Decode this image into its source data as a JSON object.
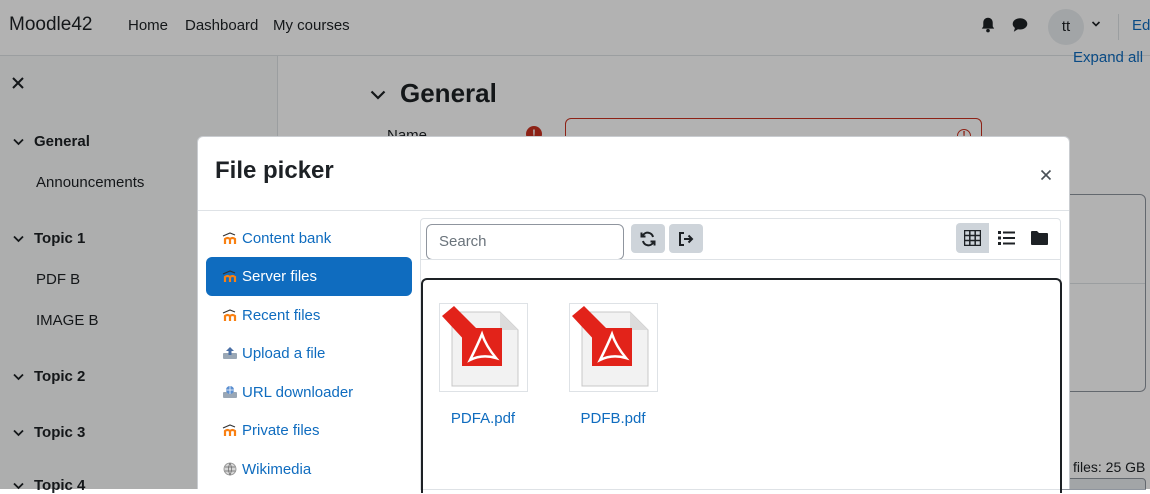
{
  "navbar": {
    "brand": "Moodle42",
    "links": [
      "Home",
      "Dashboard",
      "My courses"
    ],
    "avatar_initials": "tt",
    "edit_label": "Ed"
  },
  "course_index": {
    "sections": [
      {
        "title": "General",
        "items": [
          "Announcements"
        ]
      },
      {
        "title": "Topic 1",
        "items": [
          "PDF B",
          "IMAGE B"
        ]
      },
      {
        "title": "Topic 2",
        "items": []
      },
      {
        "title": "Topic 3",
        "items": []
      },
      {
        "title": "Topic 4",
        "items": []
      }
    ]
  },
  "main": {
    "expand_all": "Expand all",
    "section_title": "General",
    "name_label": "Name",
    "files_limit": "files: 25 GB"
  },
  "file_picker": {
    "title": "File picker",
    "repositories": [
      {
        "label": "Content bank",
        "icon": "moodle-icon",
        "active": false
      },
      {
        "label": "Server files",
        "icon": "moodle-icon",
        "active": true
      },
      {
        "label": "Recent files",
        "icon": "moodle-icon",
        "active": false
      },
      {
        "label": "Upload a file",
        "icon": "upload-icon",
        "active": false
      },
      {
        "label": "URL downloader",
        "icon": "url-icon",
        "active": false
      },
      {
        "label": "Private files",
        "icon": "moodle-icon",
        "active": false
      },
      {
        "label": "Wikimedia",
        "icon": "wikimedia-icon",
        "active": false
      }
    ],
    "search_placeholder": "Search",
    "views": [
      "icons-view",
      "list-view",
      "tree-view"
    ],
    "active_view": "icons-view",
    "files": [
      {
        "name": "PDFA.pdf",
        "icon": "pdf-file-icon"
      },
      {
        "name": "PDFB.pdf",
        "icon": "pdf-file-icon"
      }
    ]
  },
  "colors": {
    "link": "#0f6cbf",
    "active_bg": "#0f6cbf",
    "error": "#ca3120",
    "pdf_red": "#e2231a"
  }
}
